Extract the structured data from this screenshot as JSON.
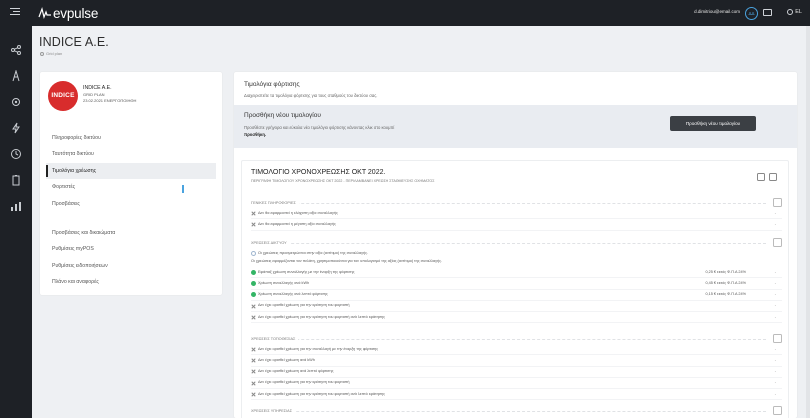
{
  "topbar": {
    "logo": "evpulse",
    "user_email": "d.dimitriou@email.com",
    "avatar_initials": "ΔΔ",
    "language": "EL"
  },
  "sidebar_icons": [
    "share-icon",
    "tower-icon",
    "network-icon",
    "bolt-icon",
    "clock-icon",
    "battery-icon",
    "chart-icon"
  ],
  "header": {
    "title": "INDICE A.E.",
    "subtitle": "Grid plan"
  },
  "station": {
    "logo_text": "INDICE",
    "name": "INDICE A.E.",
    "plan": "GRID PLAN",
    "status": "23.02.2021 ΕΝΕΡΓΟΠΟΙΗΘΗ",
    "color": "#d82c2c"
  },
  "nav": {
    "group1": [
      "Πληροφορίες δικτύου",
      "Ταυτότητα δικτύου",
      "Τιμολόγια χρέωσης",
      "Φορτιστές",
      "Προσβάσεις"
    ],
    "group2": [
      "Προσβάσεις και δικαιώματα",
      "Ρυθμίσεις myPOS",
      "Ρυθμίσεις ειδοποιήσεων",
      "Πλάνο και αναφορές"
    ],
    "active": "Τιμολόγια χρέωσης"
  },
  "main": {
    "title": "Τιμολόγια φόρτισης",
    "description": "Διαχειριστείτε τα τιμολόγια φόρτισης για τους σταθμούς του δικτύου σας.",
    "add": {
      "title": "Προσθήκη νέου τιμολογίου",
      "description": "Προσθέστε γρήγορα και εύκολα νέο τιμολόγιο φόρτισης κάνοντας κλικ στο κουμπί",
      "emphasis": "προσθήκη.",
      "button": "Προσθήκη νέου τιμολογίου"
    },
    "plan": {
      "title": "ΤΙΜΟΛΟΓΙΟ ΧΡΟΝΟΧΡΕΩΣΗΣ ΟΚΤ 2022.",
      "subtitle": "ΠΕΡΙΓΡΑΦΗ ΤΙΜΟΛΟΓΙΟΥ ΧΡΟΝΟΧΡΕΩΣΗΣ ΟΚΤ 2022 - ΠΕΡΙΛΑΜΒΑΝΕΙ ΧΡΕΩΣΗ ΣΤΑΘΜΕΥΣΗΣ ΟΧΗΜΑΤΟΣ",
      "sections": [
        {
          "header": "ΓΕΝΙΚΕΣ ΠΛΗΡΟΦΟΡΙΕΣ",
          "rows": [
            {
              "icon": "x",
              "text": "Δεν θα εφαρμοστεί η ελάχιστη αξία συναλλαγής",
              "value": "",
              "dash": "-"
            },
            {
              "icon": "x",
              "text": "Δεν θα εφαρμοστεί η μέγιστη αξία συναλλαγής",
              "value": "",
              "dash": "-"
            }
          ]
        },
        {
          "header": "ΧΡΕΩΣΕΙΣ ΔΙΚΤΥΟΥ",
          "notes": [
            "Οι χρεώσεις προσμετρώνται στην αξία (αντίτιμο) της συναλλαγής.",
            "Οι χρεώσεις εφαρμόζονται τον πελάτη, χρησιμοποιούνται για τον υπολογισμό της αξίας (αντίτιμο) της συναλλαγής."
          ],
          "rows": [
            {
              "icon": "ok",
              "text": "Εφάπαξ χρέωση συναλλαγής με την έναρξη της φόρτισης",
              "value": "0,25 € εκτός Φ.Π.Α 24%",
              "dash": "-"
            },
            {
              "icon": "ok",
              "text": "Χρέωση συναλλαγής ανά kWh",
              "value": "0,45 € εκτός Φ.Π.Α 24%",
              "dash": "-"
            },
            {
              "icon": "ok",
              "text": "Χρέωση συναλλαγής ανά λεπτό φόρτισης",
              "value": "0,15 € εκτός Φ.Π.Α 24%",
              "dash": "-"
            },
            {
              "icon": "x",
              "text": "Δεν έχει ορισθεί χρέωση για την κράτηση του φορτιστή",
              "value": "",
              "dash": "-"
            },
            {
              "icon": "x",
              "text": "Δεν έχει ορισθεί χρέωση για την κράτηση του φορτιστή ανά λεπτό κράτησης",
              "value": "",
              "dash": "-"
            }
          ]
        },
        {
          "header": "ΧΡΕΩΣΕΙΣ ΤΟΠΟΘΕΣΙΑΣ",
          "rows": [
            {
              "icon": "x",
              "text": "Δεν έχει ορισθεί χρέωση για την συναλλαγή με την έναρξη της φόρτισης",
              "value": "",
              "dash": "-"
            },
            {
              "icon": "x",
              "text": "Δεν έχει ορισθεί χρέωση ανά kWh",
              "value": "",
              "dash": "-"
            },
            {
              "icon": "x",
              "text": "Δεν έχει ορισθεί χρέωση ανά λεπτό φόρτισης",
              "value": "",
              "dash": "-"
            },
            {
              "icon": "x",
              "text": "Δεν έχει ορισθεί χρέωση για την κράτηση του φορτιστή",
              "value": "",
              "dash": "-"
            },
            {
              "icon": "x",
              "text": "Δεν έχει ορισθεί χρέωση για την κράτηση του φορτιστή ανά λεπτό κράτησης",
              "value": "",
              "dash": "-"
            }
          ]
        },
        {
          "header": "ΧΡΕΩΣΕΙΣ ΥΠΗΡΕΣΙΑΣ",
          "rows": []
        }
      ]
    }
  }
}
